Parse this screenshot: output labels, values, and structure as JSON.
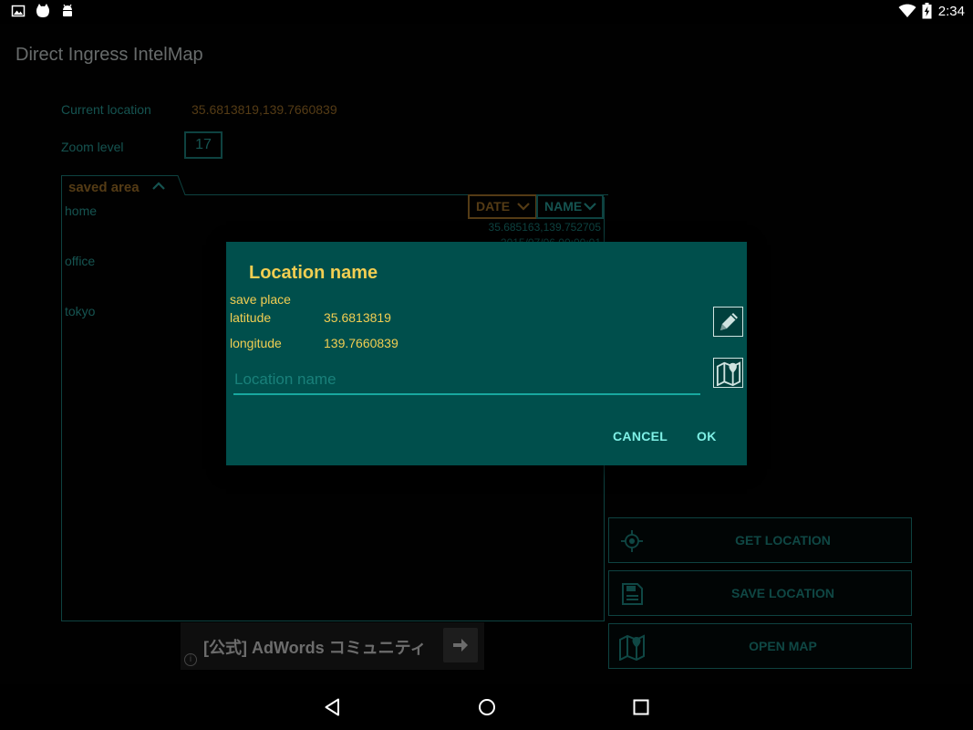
{
  "status_bar": {
    "time": "2:34",
    "left_icons": [
      "image-icon",
      "cat-icon",
      "android-icon"
    ],
    "right_icons": [
      "wifi-icon",
      "battery-charging-icon"
    ]
  },
  "app": {
    "title": "Direct Ingress IntelMap",
    "current_location_label": "Current location",
    "current_location_value": "35.6813819,139.7660839",
    "zoom_label": "Zoom level",
    "zoom_value": "17"
  },
  "saved_area": {
    "tab_label": "saved area",
    "sort_date_label": "DATE",
    "sort_name_label": "NAME",
    "items": [
      {
        "name": "home",
        "coords": "35.685163,139.752705",
        "date": "2015/07/06 00:00:01"
      },
      {
        "name": "office"
      },
      {
        "name": "tokyo"
      }
    ]
  },
  "actions": {
    "get_location": "GET LOCATION",
    "save_location": "SAVE LOCATION",
    "open_map": "OPEN MAP"
  },
  "ad": {
    "text": "[公式] AdWords コミュニティ",
    "info": "i"
  },
  "dialog": {
    "title": "Location name",
    "save_place_label": "save place",
    "latitude_label": "latitude",
    "latitude_value": "35.6813819",
    "longitude_label": "longitude",
    "longitude_value": "139.7660839",
    "input_placeholder": "Location name",
    "input_value": "",
    "cancel_label": "CANCEL",
    "ok_label": "OK"
  },
  "colors": {
    "accent_teal": "#1c8580",
    "accent_amber": "#a9762a",
    "dialog_bg": "#004f4c",
    "dialog_text": "#f2ce52",
    "dialog_button": "#7ff0e6"
  }
}
